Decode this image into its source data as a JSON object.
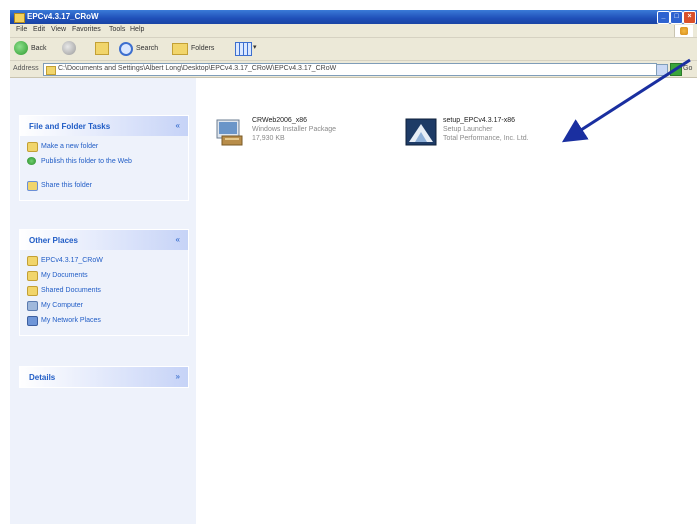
{
  "window": {
    "title": "EPCv4.3.17_CRoW",
    "min_label": "_",
    "max_label": "□",
    "close_label": "×"
  },
  "menu": [
    "File",
    "Edit",
    "View",
    "Favorites",
    "Tools",
    "Help"
  ],
  "toolbar": {
    "back": "Back",
    "search": "Search",
    "folders": "Folders"
  },
  "address": {
    "label": "Address",
    "path": "C:\\Documents and Settings\\Albert Long\\Desktop\\EPCv4.3.17_CRoW\\EPCv4.3.17_CRoW",
    "go": "Go"
  },
  "tasks": {
    "title": "File and Folder Tasks",
    "items": [
      "Make a new folder",
      "Publish this folder to the Web",
      "Share this folder"
    ]
  },
  "places": {
    "title": "Other Places",
    "items": [
      "EPCv4.3.17_CRoW",
      "My Documents",
      "Shared Documents",
      "My Computer",
      "My Network Places"
    ]
  },
  "details": {
    "title": "Details"
  },
  "files": [
    {
      "name": "CRWeb2006_x86",
      "type": "Windows Installer Package",
      "desc": "17,930 KB",
      "icon": "installer-package-icon"
    },
    {
      "name": "setup_EPCv4.3.17-x86",
      "type": "Setup Launcher",
      "desc": "Total Performance, Inc. Ltd.",
      "icon": "setup-launcher-icon"
    }
  ],
  "colors": {
    "accent": "#215dc6",
    "arrow": "#1a2fa0",
    "titlebar": "#1f4fb8"
  }
}
